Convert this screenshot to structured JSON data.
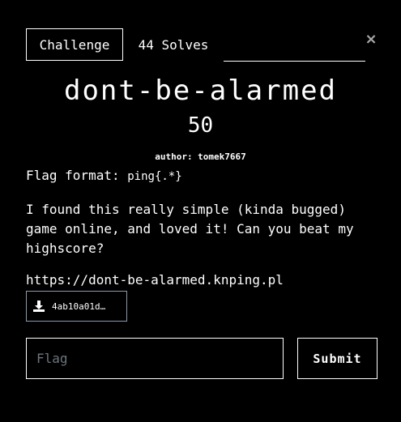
{
  "tabs": {
    "challenge_label": "Challenge",
    "solves_label": "44 Solves"
  },
  "close_icon": "×",
  "challenge": {
    "name": "dont-be-alarmed",
    "points": "50",
    "author": "author: tomek7667",
    "flag_format_label": "Flag format: ",
    "flag_format_value": "ping{.*}",
    "description": "I found this really simple (kinda bugged) game online, and loved it! Can you beat my highscore?",
    "url": "https://dont-be-alarmed.knping.pl"
  },
  "file": {
    "icon": "download-icon",
    "name": "4ab10a01d…"
  },
  "submission": {
    "placeholder": "Flag",
    "submit_label": "Submit"
  },
  "colors": {
    "background": "#000000",
    "foreground": "#ffffff",
    "file_border": "#8e9aa8",
    "placeholder": "#6c757d"
  }
}
